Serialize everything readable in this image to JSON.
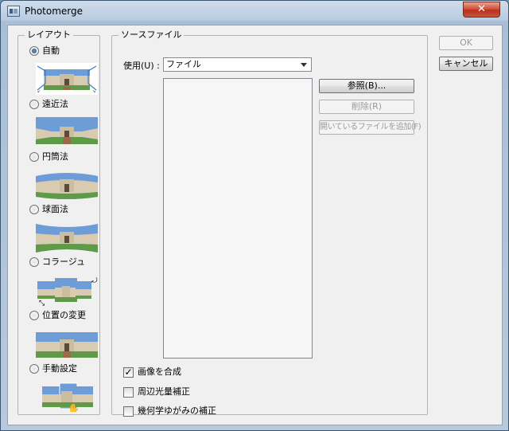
{
  "window": {
    "title": "Photomerge",
    "close_glyph": "✕"
  },
  "layout": {
    "group_title": "レイアウト",
    "options": [
      {
        "label": "自動",
        "checked": true,
        "thumb": "auto-thumbnail"
      },
      {
        "label": "遠近法",
        "checked": false,
        "thumb": "perspective-thumbnail"
      },
      {
        "label": "円筒法",
        "checked": false,
        "thumb": "cylindrical-thumbnail"
      },
      {
        "label": "球面法",
        "checked": false,
        "thumb": "spherical-thumbnail"
      },
      {
        "label": "コラージュ",
        "checked": false,
        "thumb": "collage-thumbnail"
      },
      {
        "label": "位置の変更",
        "checked": false,
        "thumb": "reposition-thumbnail"
      },
      {
        "label": "手動設定",
        "checked": false,
        "thumb": "interactive-thumbnail"
      }
    ]
  },
  "source": {
    "group_title": "ソースファイル",
    "use_label": "使用(U) :",
    "use_value": "ファイル",
    "buttons": {
      "browse": "参照(B)...",
      "remove": "削除(R)",
      "add_open": "開いているファイルを追加(F)"
    },
    "checkboxes": [
      {
        "label": "画像を合成",
        "checked": true
      },
      {
        "label": "周辺光量補正",
        "checked": false
      },
      {
        "label": "幾何学ゆがみの補正",
        "checked": false
      }
    ]
  },
  "actions": {
    "ok": "OK",
    "cancel": "キャンセル"
  },
  "colors": {
    "accent": "#3a78c8",
    "sky": "#6d9cd6",
    "building": "#d8cbb0",
    "grass": "#5f9a48"
  }
}
